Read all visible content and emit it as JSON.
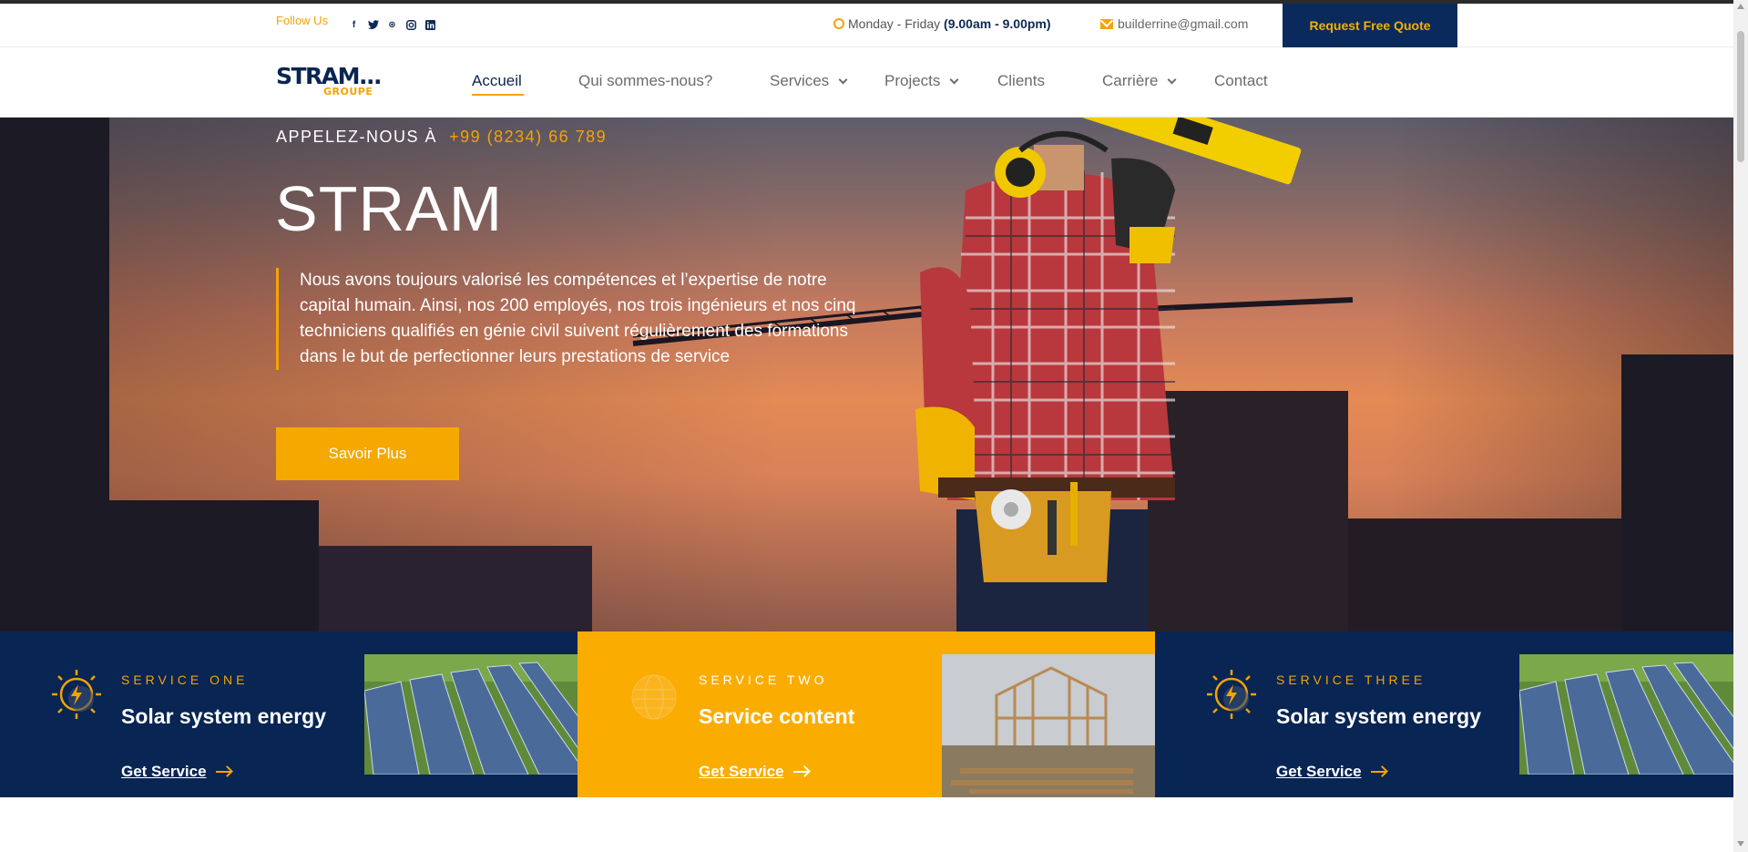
{
  "topbar": {
    "follow_label": "Follow Us",
    "socials": [
      {
        "icon": "facebook-icon",
        "glyph": "f"
      },
      {
        "icon": "twitter-icon",
        "glyph": "t"
      },
      {
        "icon": "dribbble-icon",
        "glyph": "⊛"
      },
      {
        "icon": "instagram-icon",
        "glyph": "◘"
      },
      {
        "icon": "linkedin-icon",
        "glyph": "in"
      }
    ],
    "hours_prefix": "Monday - Friday ",
    "hours_time": "(9.00am - 9.00pm)",
    "email": "builderrine@gmail.com",
    "quote_button": "Request Free Quote"
  },
  "logo": {
    "line1": "STRAM...",
    "line2": "GROUPE"
  },
  "nav": {
    "items": [
      {
        "label": "Accueil",
        "active": true
      },
      {
        "label": "Qui sommes-nous?"
      },
      {
        "label": "Services",
        "dropdown": true
      },
      {
        "label": "Projects",
        "dropdown": true
      },
      {
        "label": "Clients"
      },
      {
        "label": "Carrière",
        "dropdown": true
      },
      {
        "label": "Contact"
      }
    ]
  },
  "hero": {
    "call_label": "APPELEZ-NOUS À",
    "call_number": "+99 (8234) 66 789",
    "title": "STRAM",
    "text": "Nous avons toujours valorisé les compétences et l’expertise de notre capital humain. Ainsi, nos 200 employés, nos trois ingénieurs et nos cinq techniciens qualifiés en génie civil suivent régulièrement des formations dans le but de perfectionner leurs prestations de service",
    "button": "Savoir Plus"
  },
  "services": [
    {
      "label": "SERVICE ONE",
      "title": "Solar system energy",
      "link": "Get Service"
    },
    {
      "label": "SERVICE TWO",
      "title": "Service content",
      "link": "Get Service"
    },
    {
      "label": "SERVICE THREE",
      "title": "Solar system energy",
      "link": "Get Service"
    }
  ],
  "colors": {
    "navy": "#0b2a5c",
    "gold": "#f5a300"
  }
}
